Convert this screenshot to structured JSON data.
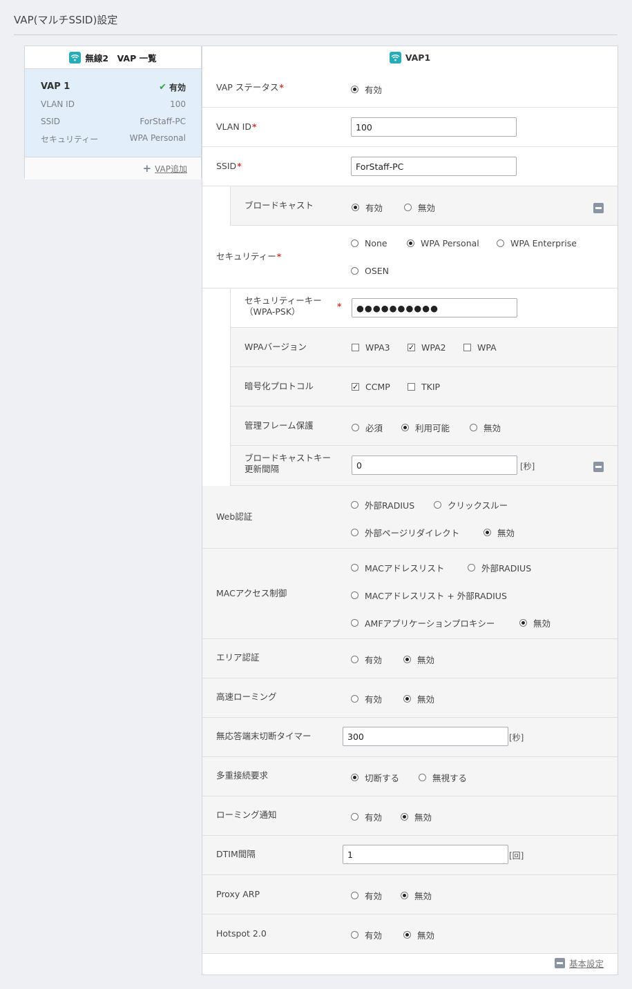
{
  "page": {
    "title": "VAP(マルチSSID)設定"
  },
  "left_panel": {
    "header": "無線2　VAP 一覧",
    "vap": {
      "name": "VAP 1",
      "status": "有効",
      "rows": [
        {
          "label": "VLAN ID",
          "value": "100"
        },
        {
          "label": "SSID",
          "value": "ForStaff-PC"
        },
        {
          "label": "セキュリティー",
          "value": "WPA Personal"
        }
      ]
    },
    "add_label": "VAP追加"
  },
  "form": {
    "header": "VAP1",
    "vap_status": {
      "label": "VAP ステータス",
      "options": [
        "有効"
      ],
      "selected": "有効"
    },
    "vlan_id": {
      "label": "VLAN ID",
      "value": "100"
    },
    "ssid": {
      "label": "SSID",
      "value": "ForStaff-PC"
    },
    "broadcast": {
      "label": "ブロードキャスト",
      "options": [
        "有効",
        "無効"
      ],
      "selected": "有効"
    },
    "security": {
      "label": "セキュリティー",
      "options": [
        "None",
        "WPA Personal",
        "WPA Enterprise",
        "OSEN"
      ],
      "selected": "WPA Personal"
    },
    "security_key": {
      "label_line1": "セキュリティーキー",
      "label_line2": "（WPA-PSK）",
      "value": "●●●●●●●●●●"
    },
    "wpa_version": {
      "label": "WPAバージョン",
      "options": [
        "WPA3",
        "WPA2",
        "WPA"
      ],
      "checked": [
        "WPA2"
      ]
    },
    "encryption": {
      "label": "暗号化プロトコル",
      "options": [
        "CCMP",
        "TKIP"
      ],
      "checked": [
        "CCMP"
      ]
    },
    "mgmt_frame": {
      "label": "管理フレーム保護",
      "options": [
        "必須",
        "利用可能",
        "無効"
      ],
      "selected": "利用可能"
    },
    "broadcast_key": {
      "label_line1": "ブロードキャストキー",
      "label_line2": "更新間隔",
      "value": "0",
      "unit": "[秒]"
    },
    "web_auth": {
      "label": "Web認証",
      "options": [
        "外部RADIUS",
        "クリックスルー",
        "外部ページリダイレクト",
        "無効"
      ],
      "selected": "無効"
    },
    "mac_access": {
      "label": "MACアクセス制御",
      "options": [
        "MACアドレスリスト",
        "外部RADIUS",
        "MACアドレスリスト + 外部RADIUS",
        "AMFアプリケーションプロキシー",
        "無効"
      ],
      "selected": "無効"
    },
    "area_auth": {
      "label": "エリア認証",
      "options": [
        "有効",
        "無効"
      ],
      "selected": "無効"
    },
    "fast_roaming": {
      "label": "高速ローミング",
      "options": [
        "有効",
        "無効"
      ],
      "selected": "無効"
    },
    "inactivity_timer": {
      "label": "無応答端末切断タイマー",
      "value": "300",
      "unit": "[秒]"
    },
    "multi_connect": {
      "label": "多重接続要求",
      "options": [
        "切断する",
        "無視する"
      ],
      "selected": "切断する"
    },
    "roaming_notify": {
      "label": "ローミング通知",
      "options": [
        "有効",
        "無効"
      ],
      "selected": "無効"
    },
    "dtim": {
      "label": "DTIM間隔",
      "value": "1",
      "unit": "[回]"
    },
    "proxy_arp": {
      "label": "Proxy ARP",
      "options": [
        "有効",
        "無効"
      ],
      "selected": "無効"
    },
    "hotspot": {
      "label": "Hotspot 2.0",
      "options": [
        "有効",
        "無効"
      ],
      "selected": "無効"
    },
    "basic_settings_label": "基本設定"
  }
}
